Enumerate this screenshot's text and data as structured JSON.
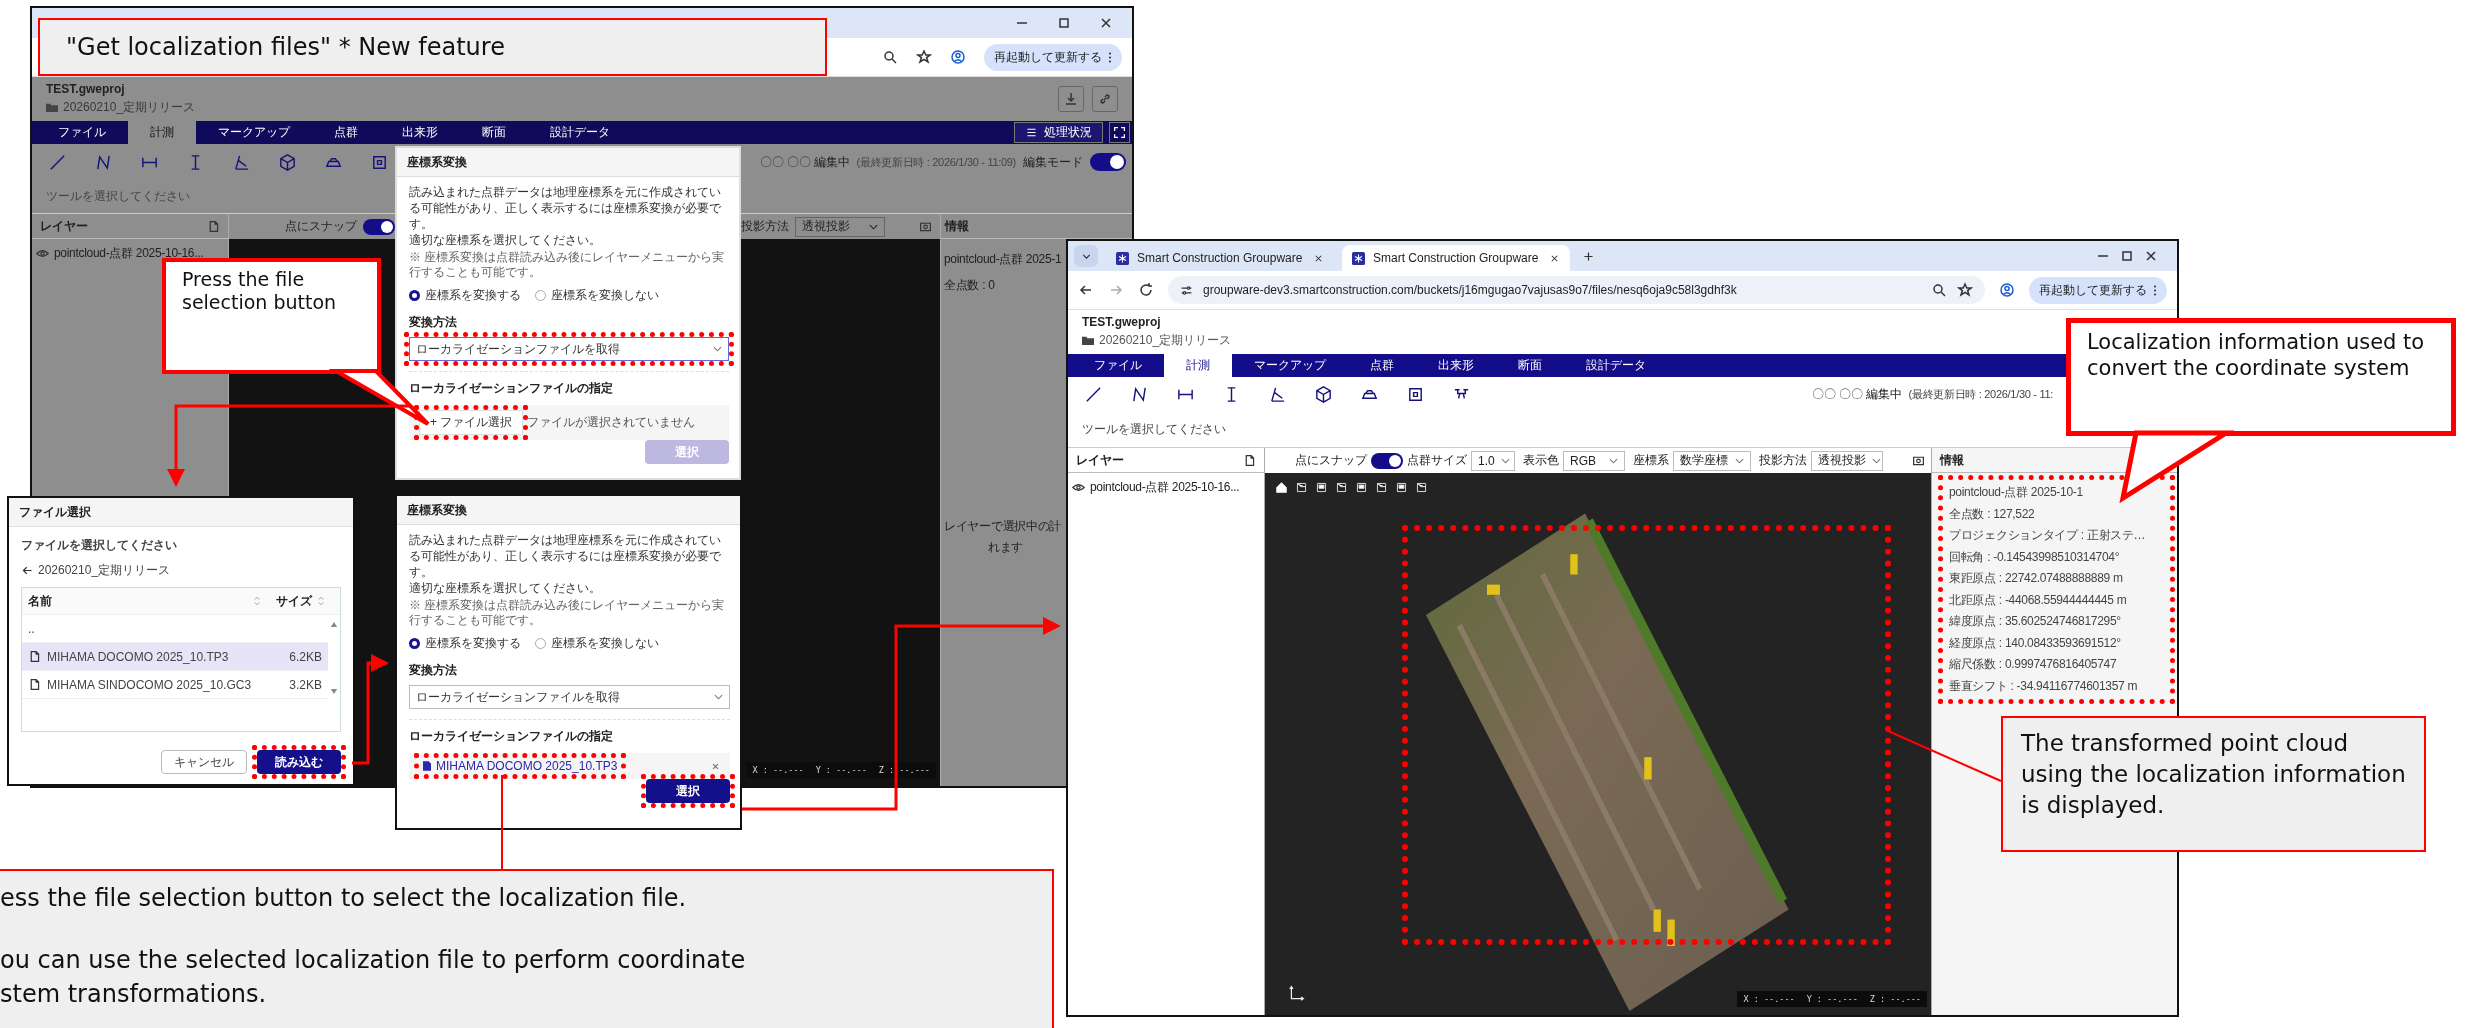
{
  "title_callout": {
    "text": "\"Get localization files\" * New feature"
  },
  "back_window": {
    "update_button": "再起動して更新する",
    "project": {
      "name": "TEST.gweproj",
      "folder": "20260210_定期リリース"
    },
    "menu": [
      {
        "label": "ファイル",
        "selected": false
      },
      {
        "label": "計測",
        "selected": true
      },
      {
        "label": "マークアップ",
        "selected": false
      },
      {
        "label": "点群",
        "selected": false
      },
      {
        "label": "出来形",
        "selected": false
      },
      {
        "label": "断面",
        "selected": false
      },
      {
        "label": "設計データ",
        "selected": false
      }
    ],
    "status_button": "処理状況",
    "editor": "〇〇 〇〇 編集中",
    "updated": "(最終更新日時 : 2026/1/30 - 11:09)",
    "edit_mode": {
      "label": "編集モード",
      "on": true
    },
    "tool_hint": "ツールを選択してください",
    "layers": {
      "title": "レイヤー",
      "items": [
        "pointcloud-点群 2025-10-16..."
      ]
    },
    "snap": {
      "label": "点にスナップ",
      "on": true
    },
    "projection": {
      "label": "投影方法",
      "value": "透視投影"
    },
    "coords": [
      "X : --.---",
      "Y : --.---",
      "Z : --.---"
    ],
    "info": {
      "title": "情報",
      "lines": [
        "pointcloud-点群 2025-1",
        "全点数 : 0"
      ],
      "note": [
        "レイヤーで選択中の計",
        "れます"
      ]
    }
  },
  "conversion_dialogs": [
    {
      "title": "座標系変換",
      "paragraphs": [
        "読み込まれた点群データは地理座標系を元に作成されている可能性があり、正しく表示するには座標系変換が必要です。",
        "適切な座標系を選択してください。"
      ],
      "note": "※ 座標系変換は点群読み込み後にレイヤーメニューから実行することも可能です。",
      "options": [
        {
          "label": "座標系を変換する",
          "selected": true
        },
        {
          "label": "座標系を変換しない",
          "selected": false
        }
      ],
      "method_label": "変換方法",
      "method": {
        "value": "ローカライゼーションファイルを取得",
        "highlighted": true
      },
      "file_label": "ローカライゼーションファイルの指定",
      "file_button": {
        "label": "+ ファイル選択",
        "highlighted": true
      },
      "file_status": "ファイルが選択されていません",
      "submit": {
        "label": "選択",
        "disabled": true,
        "highlighted": false
      }
    },
    {
      "title": "座標系変換",
      "paragraphs": [
        "読み込まれた点群データは地理座標系を元に作成されている可能性があり、正しく表示するには座標系変換が必要です。",
        "適切な座標系を選択してください。"
      ],
      "note": "※ 座標系変換は点群読み込み後にレイヤーメニューから実行することも可能です。",
      "options": [
        {
          "label": "座標系を変換する",
          "selected": true
        },
        {
          "label": "座標系を変換しない",
          "selected": false
        }
      ],
      "method_label": "変換方法",
      "method": {
        "value": "ローカライゼーションファイルを取得",
        "highlighted": false
      },
      "file_label": "ローカライゼーションファイルの指定",
      "selected_file": {
        "name": "MIHAMA DOCOMO 2025_10.TP3",
        "highlighted": true
      },
      "submit": {
        "label": "選択",
        "disabled": false,
        "highlighted": true
      }
    }
  ],
  "file_dialog": {
    "title": "ファイル選択",
    "prompt": "ファイルを選択してください",
    "folder": "20260210_定期リリース",
    "columns": [
      "名前",
      "サイズ"
    ],
    "parent": "..",
    "files": [
      {
        "name": "MIHAMA DOCOMO 2025_10.TP3",
        "size": "6.2KB",
        "selected": true
      },
      {
        "name": "MIHAMA SINDOCOMO 2025_10.GC3",
        "size": "3.2KB",
        "selected": false
      }
    ],
    "cancel": "キャンセル",
    "load": {
      "label": "読み込む",
      "highlighted": true
    }
  },
  "right_window": {
    "tabs": [
      {
        "title": "Smart Construction Groupware",
        "selected": false
      },
      {
        "title": "Smart Construction Groupware",
        "selected": true
      }
    ],
    "url": "groupware-dev3.smartconstruction.com/buckets/j16mgugao7vajusas9o7/files/nesq6oja9c58l3gdhf3k",
    "update_button": "再起動して更新する",
    "project": {
      "name": "TEST.gweproj",
      "folder": "20260210_定期リリース"
    },
    "menu": [
      {
        "label": "ファイル",
        "selected": false
      },
      {
        "label": "計測",
        "selected": true
      },
      {
        "label": "マークアップ",
        "selected": false
      },
      {
        "label": "点群",
        "selected": false
      },
      {
        "label": "出来形",
        "selected": false
      },
      {
        "label": "断面",
        "selected": false
      },
      {
        "label": "設計データ",
        "selected": false
      }
    ],
    "editor": "〇〇 〇〇 編集中",
    "updated": "(最終更新日時 : 2026/1/30 - 11:",
    "tool_hint": "ツールを選択してください",
    "layers": {
      "title": "レイヤー",
      "items": [
        "pointcloud-点群 2025-10-16..."
      ]
    },
    "snap": {
      "label": "点にスナップ",
      "on": true
    },
    "selects": [
      {
        "label": "点群サイズ",
        "value": "1.0"
      },
      {
        "label": "表示色",
        "value": "RGB"
      },
      {
        "label": "座標系",
        "value": "数学座標"
      },
      {
        "label": "投影方法",
        "value": "透視投影"
      }
    ],
    "viewport": {
      "highlighted": true
    },
    "coords": [
      "X : --.---",
      "Y : --.---",
      "Z : --.---"
    ],
    "info": {
      "title": "情報",
      "highlighted": true,
      "lines": [
        "pointcloud-点群 2025-10-1",
        "全点数 : 127,522",
        "プロジェクションタイプ : 正射ステ…",
        "回転角 : -0.14543998510314704°",
        "東距原点 : 22742.07488888889 m",
        "北距原点 : -44068.55944444445 m",
        "緯度原点 : 35.602524746817295°",
        "経度原点 : 140.08433593691512°",
        "縮尺係数 : 0.9997476816405747",
        "垂直シフト : -34.94116774601357 m"
      ]
    }
  },
  "callouts": {
    "press": "Press the file selection button",
    "info": "Localization information used to convert the coordinate system",
    "cloud": "The transformed point cloud using the localization information is displayed.",
    "bottom": [
      [
        "ess the file selection button to select the localization file."
      ],
      [
        "ou can use the selected localization file to perform coordinate",
        "stem transformations."
      ]
    ]
  }
}
